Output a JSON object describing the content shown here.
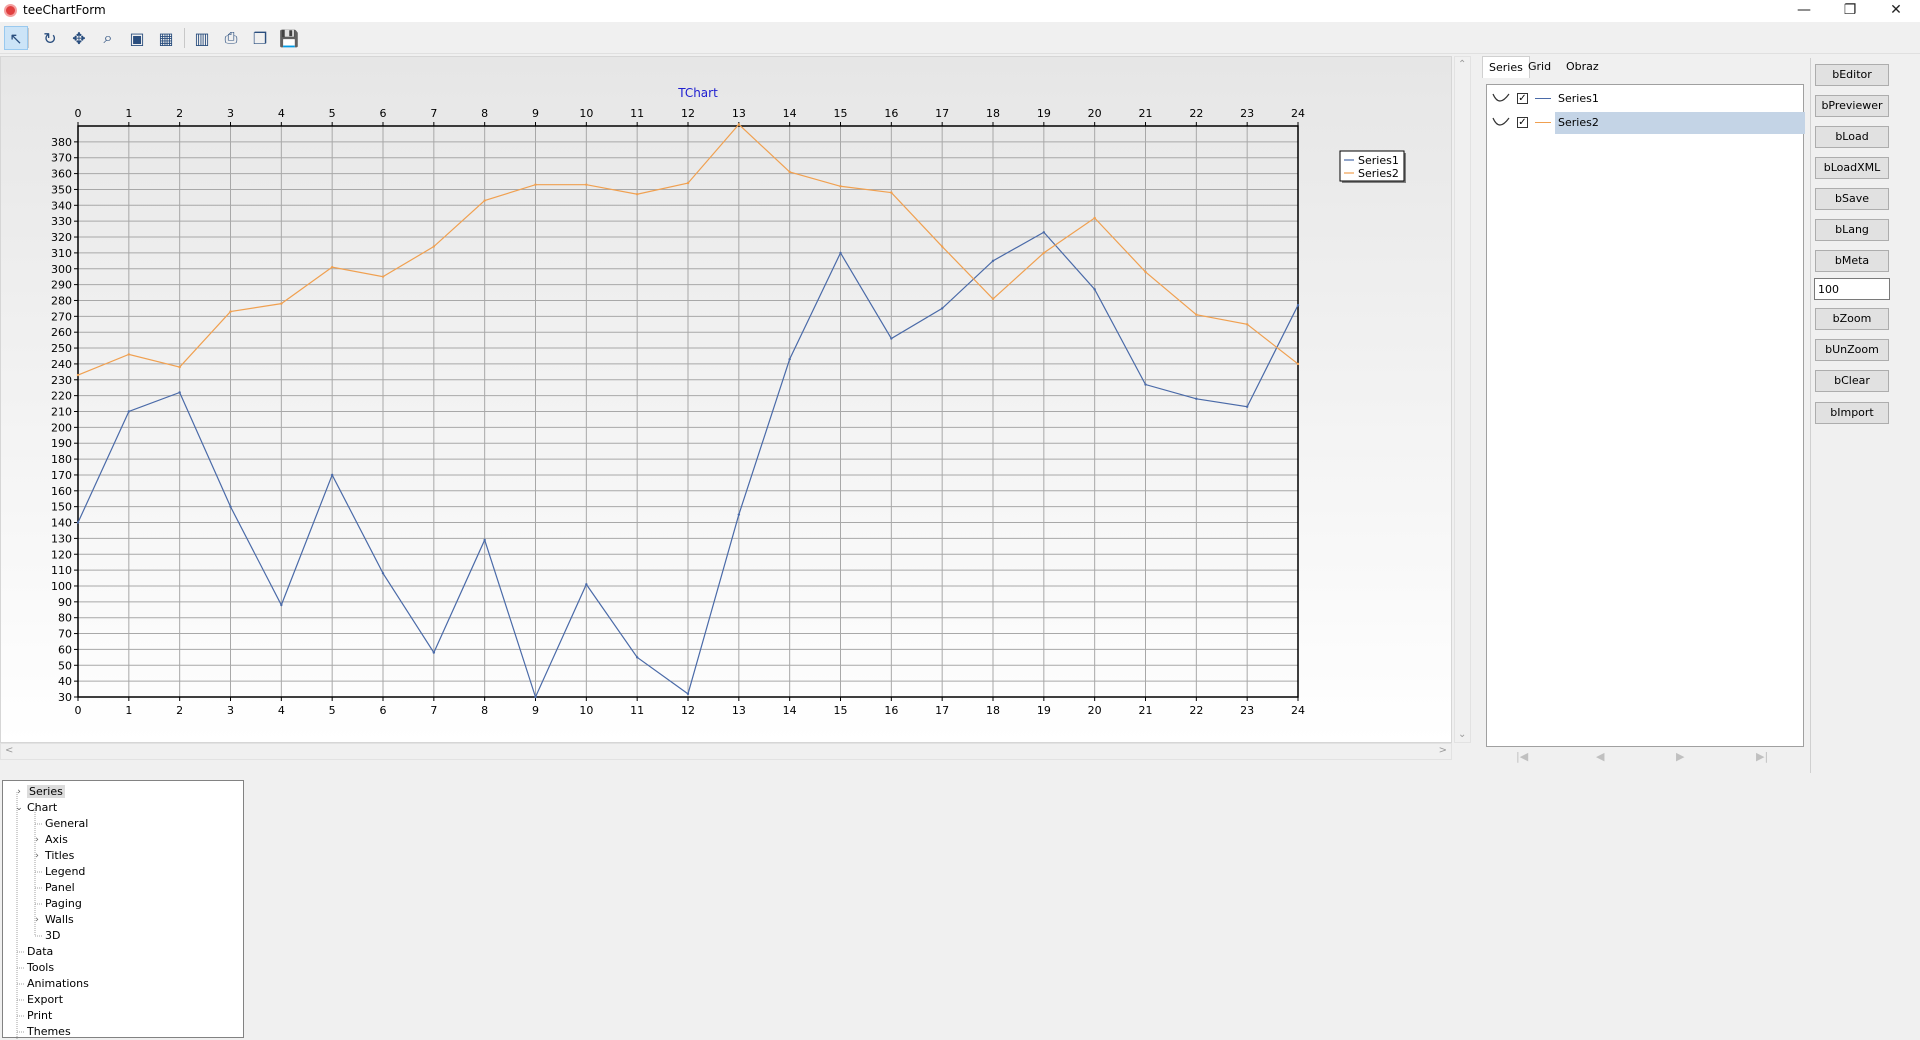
{
  "window": {
    "title": "teeChartForm",
    "controls": [
      "—",
      "❐",
      "✕"
    ]
  },
  "toolbar": {
    "tools": [
      {
        "name": "select-pointer",
        "glyph": "↖",
        "active": true
      },
      {
        "name": "rotate",
        "glyph": "↻",
        "active": false
      },
      {
        "name": "move",
        "glyph": "✥",
        "active": false
      },
      {
        "name": "zoom",
        "glyph": "⌕",
        "active": false
      },
      {
        "name": "depth",
        "glyph": "▣",
        "active": false
      },
      {
        "name": "view3d",
        "glyph": "▦",
        "active": false
      },
      {
        "name": "editor",
        "glyph": "▥",
        "active": false
      },
      {
        "name": "print",
        "glyph": "⎙",
        "active": false
      },
      {
        "name": "copy",
        "glyph": "❐",
        "active": false
      },
      {
        "name": "save",
        "glyph": "💾",
        "active": false
      }
    ]
  },
  "chart_data": {
    "type": "line",
    "title": "TChart",
    "x": [
      0,
      1,
      2,
      3,
      4,
      5,
      6,
      7,
      8,
      9,
      10,
      11,
      12,
      13,
      14,
      15,
      16,
      17,
      18,
      19,
      20,
      21,
      22,
      23,
      24
    ],
    "xlim": [
      0,
      24
    ],
    "ylim": [
      30,
      390
    ],
    "yticks": [
      30,
      40,
      50,
      60,
      70,
      80,
      90,
      100,
      110,
      120,
      130,
      140,
      150,
      160,
      170,
      180,
      190,
      200,
      210,
      220,
      230,
      240,
      250,
      260,
      270,
      280,
      290,
      300,
      310,
      320,
      330,
      340,
      350,
      360,
      370,
      380
    ],
    "grid": true,
    "legend_position": "top-right",
    "series": [
      {
        "name": "Series1",
        "color": "#4a6aa8",
        "values": [
          140,
          210,
          222,
          150,
          88,
          170,
          108,
          58,
          129,
          30,
          101,
          55,
          32,
          145,
          243,
          310,
          256,
          275,
          305,
          323,
          287,
          227,
          218,
          213,
          277
        ]
      },
      {
        "name": "Series2",
        "color": "#f0a050",
        "values": [
          233,
          246,
          238,
          273,
          278,
          301,
          295,
          314,
          343,
          353,
          353,
          347,
          354,
          391,
          361,
          352,
          348,
          314,
          281,
          310,
          332,
          298,
          271,
          265,
          240
        ]
      }
    ]
  },
  "tabs": [
    "Series",
    "Grid",
    "Obraz"
  ],
  "series_list": [
    {
      "label": "Series1",
      "checked": "✓",
      "color": "#4a6aa8",
      "selected": false
    },
    {
      "label": "Series2",
      "checked": "✓",
      "color": "#f0a050",
      "selected": true
    }
  ],
  "nav": [
    "|◀",
    "◀",
    "▶",
    "▶|"
  ],
  "buttons_top": [
    "bEditor",
    "bPreviewer",
    "bLoad",
    "bLoadXML",
    "bSave",
    "bLang",
    "bMeta"
  ],
  "zoom_value": "100",
  "buttons_bottom": [
    "bZoom",
    "bUnZoom",
    "bClear",
    "bImport"
  ],
  "tree": [
    {
      "label": "Series",
      "level": 0,
      "expander": "›",
      "selected": true
    },
    {
      "label": "Chart",
      "level": 0,
      "expander": "⌄",
      "selected": false
    },
    {
      "label": "General",
      "level": 1,
      "expander": "",
      "selected": false
    },
    {
      "label": "Axis",
      "level": 1,
      "expander": "›",
      "selected": false
    },
    {
      "label": "Titles",
      "level": 1,
      "expander": "›",
      "selected": false
    },
    {
      "label": "Legend",
      "level": 1,
      "expander": "",
      "selected": false
    },
    {
      "label": "Panel",
      "level": 1,
      "expander": "",
      "selected": false
    },
    {
      "label": "Paging",
      "level": 1,
      "expander": "",
      "selected": false
    },
    {
      "label": "Walls",
      "level": 1,
      "expander": "›",
      "selected": false
    },
    {
      "label": "3D",
      "level": 1,
      "expander": "",
      "selected": false
    },
    {
      "label": "Data",
      "level": 0,
      "expander": "",
      "selected": false
    },
    {
      "label": "Tools",
      "level": 0,
      "expander": "",
      "selected": false
    },
    {
      "label": "Animations",
      "level": 0,
      "expander": "",
      "selected": false
    },
    {
      "label": "Export",
      "level": 0,
      "expander": "",
      "selected": false
    },
    {
      "label": "Print",
      "level": 0,
      "expander": "",
      "selected": false
    },
    {
      "label": "Themes",
      "level": 0,
      "expander": "",
      "selected": false
    }
  ]
}
